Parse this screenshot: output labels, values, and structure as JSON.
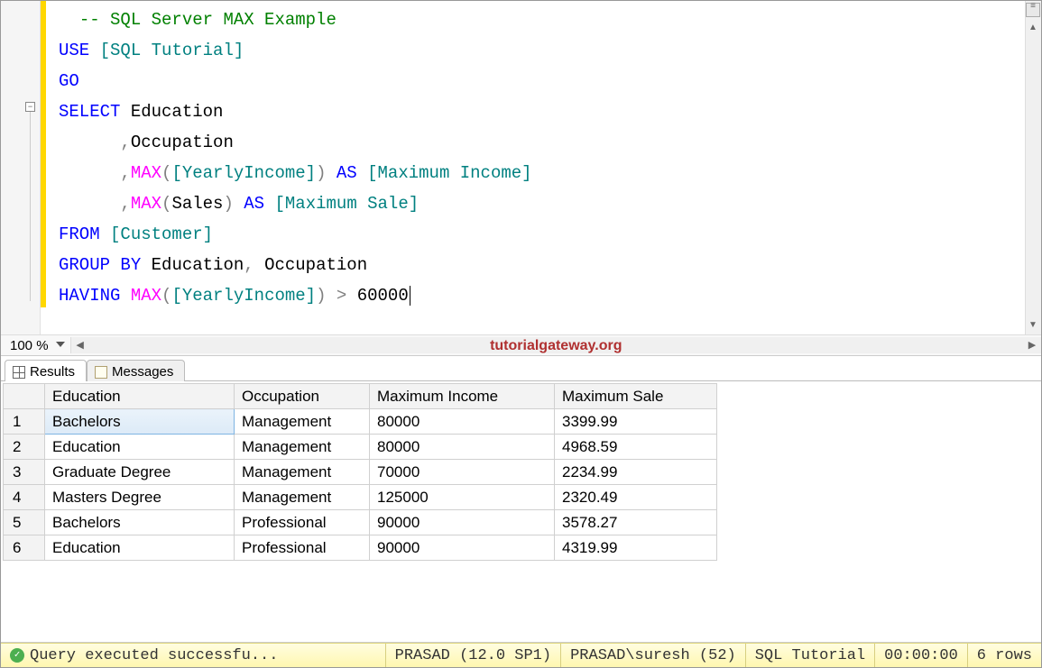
{
  "editor": {
    "zoom": "100 %",
    "code_tokens": [
      [
        {
          "t": "  ",
          "c": ""
        },
        {
          "t": "-- SQL Server MAX Example",
          "c": "kw-green"
        }
      ],
      [
        {
          "t": "USE",
          "c": "kw-blue"
        },
        {
          "t": " ",
          "c": ""
        },
        {
          "t": "[SQL Tutorial]",
          "c": "kw-teal"
        }
      ],
      [
        {
          "t": "GO",
          "c": "kw-blue"
        }
      ],
      [
        {
          "t": "SELECT",
          "c": "kw-blue"
        },
        {
          "t": " Education",
          "c": ""
        }
      ],
      [
        {
          "t": "      ",
          "c": ""
        },
        {
          "t": ",",
          "c": "kw-gray"
        },
        {
          "t": "Occupation",
          "c": ""
        }
      ],
      [
        {
          "t": "      ",
          "c": ""
        },
        {
          "t": ",",
          "c": "kw-gray"
        },
        {
          "t": "MAX",
          "c": "kw-magenta"
        },
        {
          "t": "(",
          "c": "kw-gray"
        },
        {
          "t": "[YearlyIncome]",
          "c": "kw-teal"
        },
        {
          "t": ")",
          "c": "kw-gray"
        },
        {
          "t": " ",
          "c": ""
        },
        {
          "t": "AS",
          "c": "kw-blue"
        },
        {
          "t": " ",
          "c": ""
        },
        {
          "t": "[Maximum Income]",
          "c": "kw-teal"
        }
      ],
      [
        {
          "t": "      ",
          "c": ""
        },
        {
          "t": ",",
          "c": "kw-gray"
        },
        {
          "t": "MAX",
          "c": "kw-magenta"
        },
        {
          "t": "(",
          "c": "kw-gray"
        },
        {
          "t": "Sales",
          "c": ""
        },
        {
          "t": ")",
          "c": "kw-gray"
        },
        {
          "t": " ",
          "c": ""
        },
        {
          "t": "AS",
          "c": "kw-blue"
        },
        {
          "t": " ",
          "c": ""
        },
        {
          "t": "[Maximum Sale]",
          "c": "kw-teal"
        }
      ],
      [
        {
          "t": "FROM",
          "c": "kw-blue"
        },
        {
          "t": " ",
          "c": ""
        },
        {
          "t": "[Customer]",
          "c": "kw-teal"
        }
      ],
      [
        {
          "t": "GROUP",
          "c": "kw-blue"
        },
        {
          "t": " ",
          "c": ""
        },
        {
          "t": "BY",
          "c": "kw-blue"
        },
        {
          "t": " Education",
          "c": ""
        },
        {
          "t": ",",
          "c": "kw-gray"
        },
        {
          "t": " Occupation",
          "c": ""
        }
      ],
      [
        {
          "t": "HAVING",
          "c": "kw-blue"
        },
        {
          "t": " ",
          "c": ""
        },
        {
          "t": "MAX",
          "c": "kw-magenta"
        },
        {
          "t": "(",
          "c": "kw-gray"
        },
        {
          "t": "[YearlyIncome]",
          "c": "kw-teal"
        },
        {
          "t": ")",
          "c": "kw-gray"
        },
        {
          "t": " ",
          "c": ""
        },
        {
          "t": ">",
          "c": "kw-gray"
        },
        {
          "t": " 60000",
          "c": ""
        }
      ]
    ]
  },
  "watermark": "tutorialgateway.org",
  "tabs": {
    "results": "Results",
    "messages": "Messages"
  },
  "grid": {
    "headers": [
      "Education",
      "Occupation",
      "Maximum Income",
      "Maximum Sale"
    ],
    "rows": [
      [
        "Bachelors",
        "Management",
        "80000",
        "3399.99"
      ],
      [
        "Education",
        "Management",
        "80000",
        "4968.59"
      ],
      [
        "Graduate Degree",
        "Management",
        "70000",
        "2234.99"
      ],
      [
        "Masters Degree",
        "Management",
        "125000",
        "2320.49"
      ],
      [
        "Bachelors",
        "Professional",
        "90000",
        "3578.27"
      ],
      [
        "Education",
        "Professional",
        "90000",
        "4319.99"
      ]
    ]
  },
  "status": {
    "message": "Query executed successfu...",
    "server": "PRASAD (12.0 SP1)",
    "user": "PRASAD\\suresh (52)",
    "database": "SQL Tutorial",
    "elapsed": "00:00:00",
    "rowcount": "6 rows"
  }
}
